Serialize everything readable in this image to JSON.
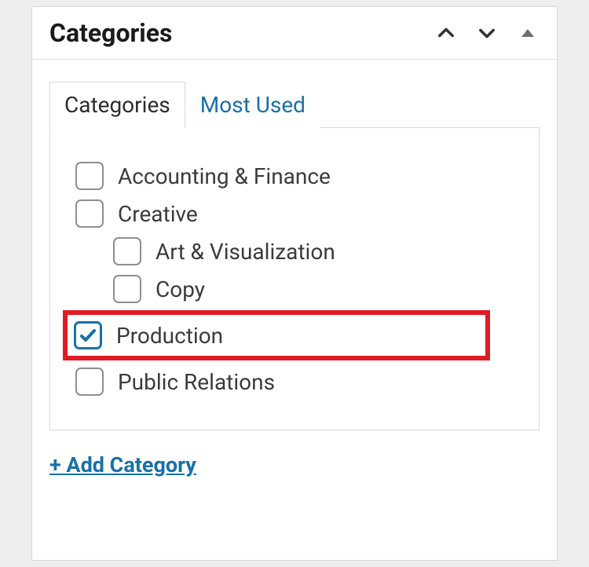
{
  "panel": {
    "title": "Categories"
  },
  "tabs": {
    "categories": "Categories",
    "most_used": "Most Used"
  },
  "categories": [
    {
      "label": "Accounting & Finance",
      "checked": false,
      "child": false,
      "highlighted": false
    },
    {
      "label": "Creative",
      "checked": false,
      "child": false,
      "highlighted": false
    },
    {
      "label": "Art & Visualization",
      "checked": false,
      "child": true,
      "highlighted": false
    },
    {
      "label": "Copy",
      "checked": false,
      "child": true,
      "highlighted": false
    },
    {
      "label": "Production",
      "checked": true,
      "child": false,
      "highlighted": true
    },
    {
      "label": "Public Relations",
      "checked": false,
      "child": false,
      "highlighted": false
    }
  ],
  "actions": {
    "add_category": "+ Add Category"
  },
  "colors": {
    "link": "#1871a6",
    "highlight_border": "#e01b24"
  }
}
